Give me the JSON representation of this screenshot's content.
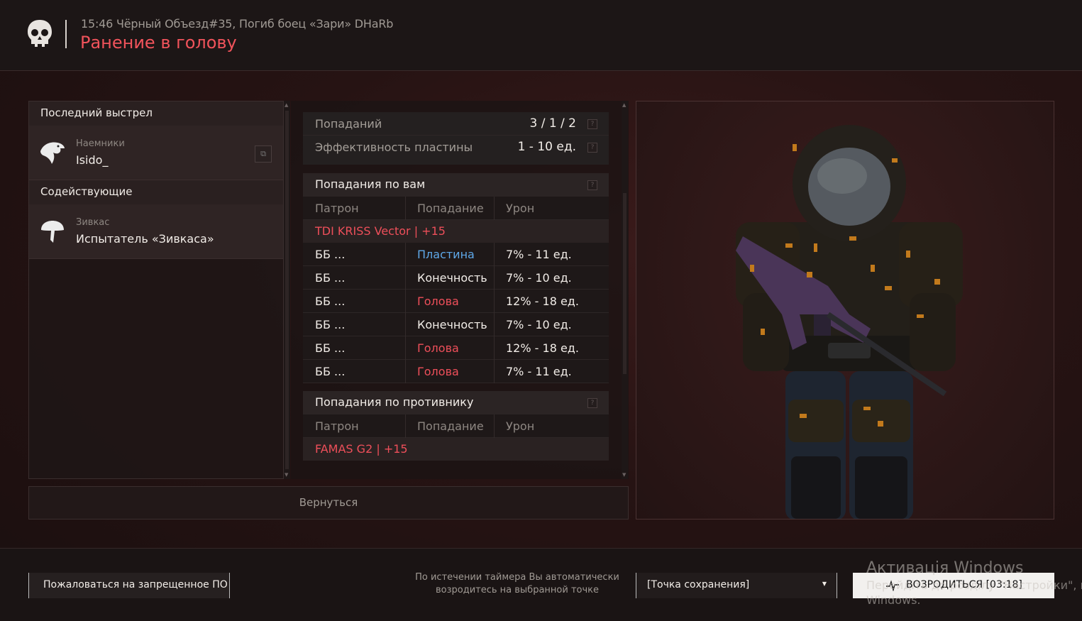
{
  "header": {
    "info": "15:46 Чёрный Объезд#35, Погиб боец «Зари» DHaRb",
    "title": "Ранение в голову"
  },
  "left_panel": {
    "last_shot_title": "Последний выстрел",
    "killer": {
      "group": "Наемники",
      "name": "Isido_"
    },
    "assist_title": "Содействующие",
    "assistant": {
      "group": "Зивкас",
      "name": "Испытатель «Зивкаса»"
    }
  },
  "stats": {
    "hits_label": "Попаданий",
    "hits_value": "3 / 1 / 2",
    "plate_label": "Эффективность пластины",
    "plate_value": "1 - 10 ед."
  },
  "hits_on_you": {
    "title": "Попадания по вам",
    "columns": [
      "Патрон",
      "Попадание",
      "Урон"
    ],
    "weapon": "TDI KRISS Vector  |  +15",
    "rows": [
      {
        "ammo": "ББ ...",
        "hit": "Пластина",
        "damage": "7% - 11 ед.",
        "hit_color": "#5fa8e8"
      },
      {
        "ammo": "ББ ...",
        "hit": "Конечность",
        "damage": "7% - 10 ед.",
        "hit_color": "#f2ede8"
      },
      {
        "ammo": "ББ ...",
        "hit": "Голова",
        "damage": "12% - 18 ед.",
        "hit_color": "#ee4f5a"
      },
      {
        "ammo": "ББ ...",
        "hit": "Конечность",
        "damage": "7% - 10 ед.",
        "hit_color": "#f2ede8"
      },
      {
        "ammo": "ББ ...",
        "hit": "Голова",
        "damage": "12% - 18 ед.",
        "hit_color": "#ee4f5a"
      },
      {
        "ammo": "ББ ...",
        "hit": "Голова",
        "damage": "7% - 11 ед.",
        "hit_color": "#ee4f5a"
      }
    ]
  },
  "hits_on_enemy": {
    "title": "Попадания по противнику",
    "columns": [
      "Патрон",
      "Попадание",
      "Урон"
    ],
    "weapon": "FAMAS G2  |  +15"
  },
  "help_icon": "?",
  "back_button": "Вернуться",
  "footer": {
    "report_button": "Пожаловаться на запрещенное ПО",
    "timer_note_line1": "По истечении таймера Вы автоматически",
    "timer_note_line2": "возродитесь на выбранной точке",
    "spawn_point": "[Точка сохранения]",
    "respawn_button": "ВОЗРОДИТЬСЯ [03:18]"
  },
  "windows_activation": {
    "line1": "Активація Windows",
    "line2": "Перейдіть до розділу \"Настройки\", щ",
    "line3": "Windows."
  },
  "colors": {
    "accent_red": "#ee4f5a",
    "plate_blue": "#5fa8e8"
  }
}
